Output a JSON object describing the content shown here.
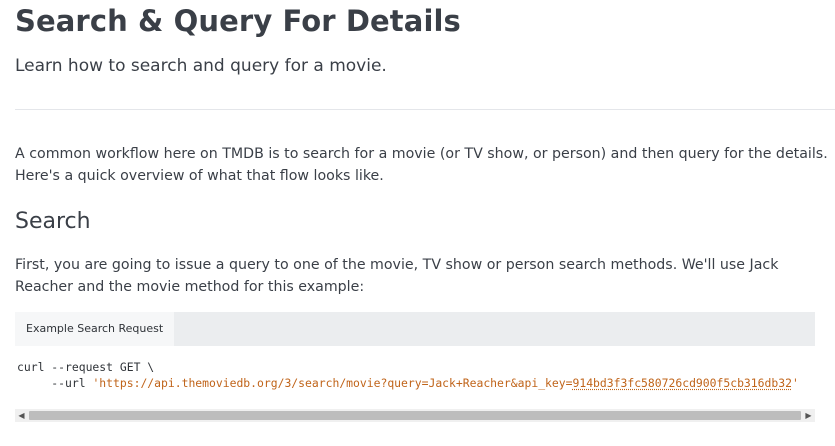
{
  "header": {
    "title": "Search & Query For Details",
    "subtitle": "Learn how to search and query for a movie."
  },
  "intro": {
    "line1": "A common workflow here on TMDB is to search for a movie (or TV show, or person) and then query for the details.",
    "line2": "Here's a quick overview of what that flow looks like."
  },
  "search_section": {
    "heading": "Search",
    "body": "First, you are going to issue a query to one of the movie, TV show or person search methods. We'll use Jack Reacher and the movie method for this example:"
  },
  "code_example": {
    "tab_label": "Example Search Request",
    "line1": "curl --request GET \\",
    "line2_prefix": "     --url ",
    "url_open": "'https://api.themoviedb.org/3/search/movie?query=Jack+Reacher&api_key=",
    "api_key": "914bd3f3fc580726cd900f5cb316db32",
    "url_close": "'"
  },
  "scrollbar": {
    "left_arrow_icon": "◀",
    "right_arrow_icon": "▶"
  }
}
